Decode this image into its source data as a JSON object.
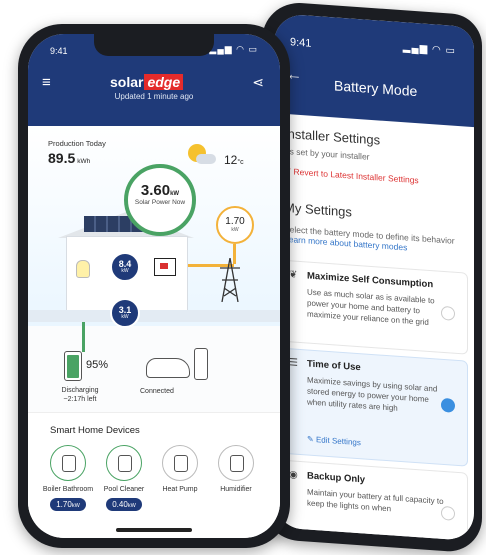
{
  "back": {
    "time": "9:41",
    "status_icons": "▂▄▆ ◠ ▭",
    "title": "Battery Mode",
    "installer_heading": "Installer Settings",
    "installer_sub": "As set by your installer",
    "revert_label": "Revert to Latest Installer Settings",
    "my_settings_heading": "My Settings",
    "my_settings_desc": "Select the battery mode to define its behavior",
    "learn_more": "Learn more about battery modes",
    "options": [
      {
        "title": "Maximize Self Consumption",
        "desc": "Use as much solar as is available to power your home and battery to maximize your reliance on the grid",
        "selected": false
      },
      {
        "title": "Time of Use",
        "desc": "Maximize savings by using solar and stored energy to power your home when utility rates are high",
        "selected": true,
        "edit": "Edit Settings"
      },
      {
        "title": "Backup Only",
        "desc": "Maintain your battery at full capacity to keep the lights on when",
        "selected": false
      }
    ]
  },
  "front": {
    "time": "9:41",
    "status_icons": "▂▄▆ ◠ ▭",
    "brand_a": "solar",
    "brand_b": "edge",
    "updated": "Updated 1 minute ago",
    "production_label": "Production Today",
    "production_value": "89.5",
    "production_unit": "kWh",
    "temperature": "12",
    "temperature_unit": "°c",
    "solar_power_value": "3.60",
    "solar_power_unit": "kW",
    "solar_power_label": "Solar Power Now",
    "grid_value": "1.70",
    "grid_unit": "kW",
    "home_flow_value": "8.4",
    "home_flow_unit": "kW",
    "battery_flow_value": "3.1",
    "battery_flow_unit": "kW",
    "battery_percent": "95%",
    "battery_level": 0.95,
    "battery_status": "Discharging ~2:17h left",
    "car_status": "Connected",
    "devices_title": "Smart Home Devices",
    "devices": [
      {
        "name": "Boiler Bathroom",
        "value": "1.70",
        "unit": "kW",
        "on": true
      },
      {
        "name": "Pool Cleaner",
        "value": "0.40",
        "unit": "kW",
        "on": true
      },
      {
        "name": "Heat Pump",
        "on": false
      },
      {
        "name": "Humidifier",
        "on": false
      }
    ]
  },
  "colors": {
    "header_blue": "#1f3a79",
    "solar_green": "#4aa364",
    "grid_orange": "#f3b23a",
    "accent_red": "#e42b2b",
    "link_blue": "#3476c9"
  }
}
